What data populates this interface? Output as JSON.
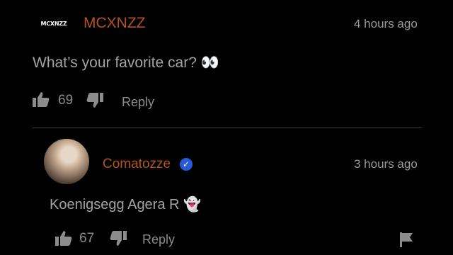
{
  "top_comment": {
    "channel_logo_text": "MCXNZZ",
    "username": "MCXNZZ",
    "timestamp": "4 hours ago",
    "text": "What’s your favorite car? 👀",
    "likes": "69",
    "reply_label": "Reply"
  },
  "reply_comment": {
    "username": "Comatozze",
    "timestamp": "3 hours ago",
    "text": "Koenigsegg Agera R 👻",
    "likes": "67",
    "reply_label": "Reply"
  },
  "colors": {
    "background": "#000000",
    "username": "#b5521c",
    "verified_badge": "#2a59d6",
    "muted_text": "#9a9a9a"
  },
  "icons": {
    "like": "thumbs-up-icon",
    "dislike": "thumbs-down-icon",
    "verified": "verified-check-icon",
    "flag": "flag-icon"
  }
}
